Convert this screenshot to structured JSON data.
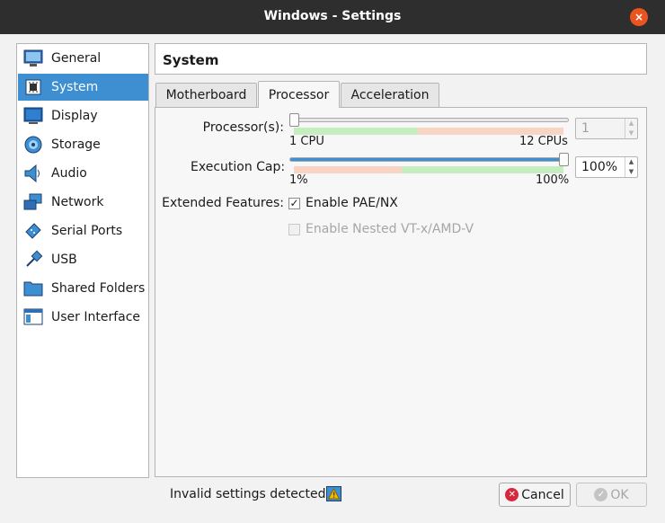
{
  "window": {
    "title": "Windows - Settings",
    "close_glyph": "×"
  },
  "sidebar": {
    "items": [
      {
        "label": "General",
        "icon": "monitor-icon"
      },
      {
        "label": "System",
        "icon": "chip-icon",
        "selected": true
      },
      {
        "label": "Display",
        "icon": "display-icon"
      },
      {
        "label": "Storage",
        "icon": "disk-icon"
      },
      {
        "label": "Audio",
        "icon": "speaker-icon"
      },
      {
        "label": "Network",
        "icon": "network-icon"
      },
      {
        "label": "Serial Ports",
        "icon": "serial-port-icon"
      },
      {
        "label": "USB",
        "icon": "usb-icon"
      },
      {
        "label": "Shared Folders",
        "icon": "folder-icon"
      },
      {
        "label": "User Interface",
        "icon": "user-interface-icon"
      }
    ]
  },
  "header": {
    "title": "System"
  },
  "tabs": [
    {
      "label": "Motherboard",
      "active": false
    },
    {
      "label": "Processor",
      "active": true
    },
    {
      "label": "Acceleration",
      "active": false
    }
  ],
  "processor": {
    "processors_label": "Processor(s):",
    "processors_min": "1 CPU",
    "processors_max": "12 CPUs",
    "processors_value": "1",
    "processors_slider_fraction": 0.0,
    "exec_cap_label": "Execution Cap:",
    "exec_cap_min": "1%",
    "exec_cap_max": "100%",
    "exec_cap_value": "100%",
    "exec_cap_slider_fraction": 1.0,
    "extended_features_label": "Extended Features:",
    "pae_label": "Enable PAE/NX",
    "pae_checked": true,
    "nested_label": "Enable Nested VT-x/AMD-V",
    "nested_checked": false
  },
  "footer": {
    "status": "Invalid settings detected",
    "cancel_label": "Cancel",
    "ok_label": "OK"
  },
  "colors": {
    "accent": "#3d8fd1",
    "titlebar": "#2e2e2e",
    "close": "#e95420",
    "cancel_icon": "#d6273b",
    "warning": "#f5b700"
  }
}
